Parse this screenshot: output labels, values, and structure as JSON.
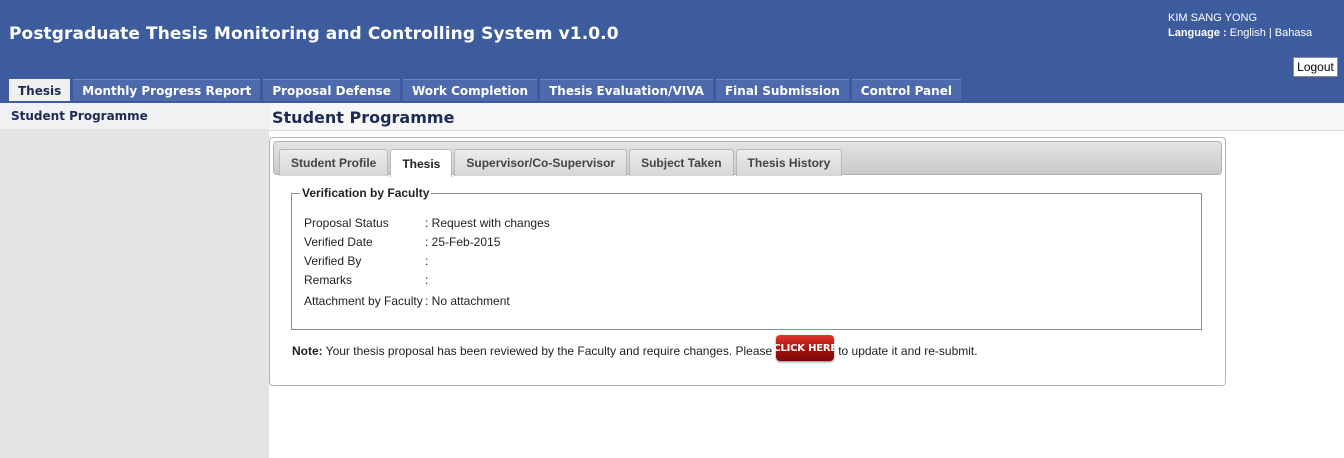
{
  "header": {
    "title": "Postgraduate Thesis Monitoring and Controlling System v1.0.0",
    "user_name": "KIM SANG YONG",
    "language_label": "Language :",
    "language_english": "English",
    "language_separator": "|",
    "language_bahasa": "Bahasa",
    "logout_label": "Logout"
  },
  "nav": {
    "tabs": [
      {
        "label": "Thesis",
        "active": true
      },
      {
        "label": "Monthly Progress Report"
      },
      {
        "label": "Proposal Defense"
      },
      {
        "label": "Work Completion"
      },
      {
        "label": "Thesis Evaluation/VIVA"
      },
      {
        "label": "Final Submission"
      },
      {
        "label": "Control Panel"
      }
    ]
  },
  "sidebar": {
    "items": [
      {
        "label": "Student Programme"
      }
    ]
  },
  "main": {
    "page_title": "Student Programme",
    "tabs": [
      {
        "label": "Student Profile"
      },
      {
        "label": "Thesis",
        "active": true
      },
      {
        "label": "Supervisor/Co-Supervisor"
      },
      {
        "label": "Subject Taken"
      },
      {
        "label": "Thesis History"
      }
    ],
    "verification": {
      "legend": "Verification by Faculty",
      "rows": [
        {
          "label": "Proposal Status",
          "value": ": Request with changes"
        },
        {
          "label": "Verified Date",
          "value": ": 25-Feb-2015"
        },
        {
          "label": "Verified By",
          "value": ":"
        },
        {
          "label": "Remarks",
          "value": ":"
        },
        {
          "label": "Attachment by Faculty",
          "value": ": No attachment"
        }
      ]
    },
    "note": {
      "prefix": "Note:",
      "text_before": "Your thesis proposal has been reviewed by the Faculty and require changes. Please",
      "button_label": "CLICK HERE",
      "text_after": "to update it and re-submit."
    }
  },
  "colors": {
    "header_bg": "#3d5c9e",
    "nav_tab_bg": "#4d6aac",
    "title_text": "#1e2c55",
    "sidebar_bg": "#e3e4e6",
    "click_button": "#b3120e"
  }
}
